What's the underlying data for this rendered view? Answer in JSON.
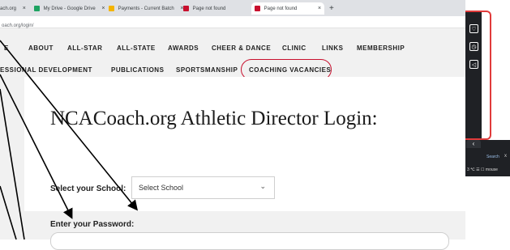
{
  "browser": {
    "tabs": [
      {
        "label": "ach.org"
      },
      {
        "label": "My Drive - Google Drive"
      },
      {
        "label": "Payments - Current Batch"
      },
      {
        "label": "Page not found"
      },
      {
        "label": "Page not found"
      }
    ],
    "new_tab": "+",
    "url": "oach.org/login/"
  },
  "nav": {
    "row1": [
      "E",
      "ABOUT",
      "ALL-STAR",
      "ALL-STATE",
      "AWARDS",
      "CHEER & DANCE",
      "CLINIC",
      "LINKS",
      "MEMBERSHIP"
    ],
    "row2": [
      "ESSIONAL DEVELOPMENT",
      "PUBLICATIONS",
      "SPORTSMANSHIP",
      "COACHING VACANCIES"
    ]
  },
  "login": {
    "title": "NCACoach.org Athletic Director Login:",
    "school_label": "Select your School:",
    "school_select_value": "Select School",
    "password_label": "Enter your Password:"
  },
  "side_panel": {
    "search_label": "Search",
    "close": "x",
    "status_text": "3 ℃ ☰ ☐ mouse"
  },
  "colors": {
    "accent_red": "#c8102e",
    "frame_red": "#e03b3b",
    "dark_panel": "#1f2125"
  }
}
